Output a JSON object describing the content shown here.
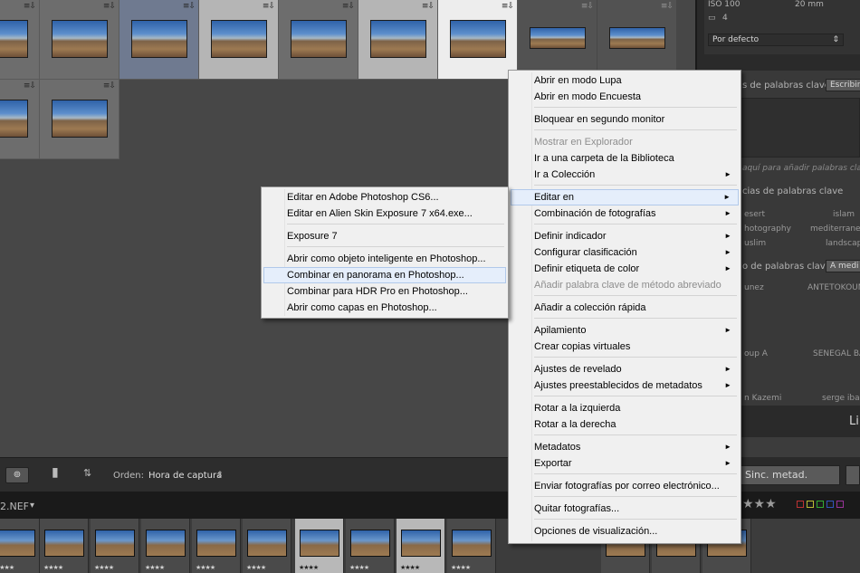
{
  "toolbar": {
    "sort_label": "Orden:",
    "sort_value": "Hora de captura",
    "sort_caret": "⇕"
  },
  "filmstrip_header": {
    "file_name": "2.NEF",
    "caret": "▾"
  },
  "right_panel": {
    "iso": "ISO 100",
    "focal": "20 mm",
    "count": "4",
    "preset_value": "Por defecto",
    "kw_tags_label": "s de palabras clave",
    "kw_enter_button": "Escribir",
    "kw_add_hint": "aquí para añadir palabras clave",
    "kw_suggest_label": "cias de palabras clave",
    "suggest_keywords": [
      "esert",
      "islam",
      "hotography",
      "mediterranean",
      "uslim",
      "landscape"
    ],
    "kw_set_label": "o de palabras clave",
    "kw_set_button": "A medi",
    "set_keywords": [
      "unez",
      "ANTETOKOUN",
      "oup A",
      "SENEGAL BA",
      "n Kazemi",
      "serge ibaka"
    ],
    "lib_letter": "Li",
    "sync_button": "Sinc. metad.",
    "stars": "★★★"
  },
  "context_menu": {
    "items": [
      {
        "label": "Abrir en modo Lupa",
        "disabled": false,
        "submenu": false
      },
      {
        "label": "Abrir en modo Encuesta",
        "disabled": false,
        "submenu": false
      },
      {
        "label": "Bloquear en segundo monitor",
        "disabled": false,
        "submenu": false
      },
      {
        "label": "Mostrar en Explorador",
        "disabled": true,
        "submenu": false
      },
      {
        "label": "Ir a una carpeta de la Biblioteca",
        "disabled": false,
        "submenu": false
      },
      {
        "label": "Ir a Colección",
        "disabled": false,
        "submenu": true
      },
      {
        "label": "Editar en",
        "disabled": false,
        "submenu": true
      },
      {
        "label": "Combinación de fotografías",
        "disabled": false,
        "submenu": true
      },
      {
        "label": "Definir indicador",
        "disabled": false,
        "submenu": true
      },
      {
        "label": "Configurar clasificación",
        "disabled": false,
        "submenu": true
      },
      {
        "label": "Definir etiqueta de color",
        "disabled": false,
        "submenu": true
      },
      {
        "label": "Añadir palabra clave de método abreviado",
        "disabled": true,
        "submenu": false
      },
      {
        "label": "Añadir a colección rápida",
        "disabled": false,
        "submenu": false
      },
      {
        "label": "Apilamiento",
        "disabled": false,
        "submenu": true
      },
      {
        "label": "Crear copias virtuales",
        "disabled": false,
        "submenu": false
      },
      {
        "label": "Ajustes de revelado",
        "disabled": false,
        "submenu": true
      },
      {
        "label": "Ajustes preestablecidos de metadatos",
        "disabled": false,
        "submenu": true
      },
      {
        "label": "Rotar a la izquierda",
        "disabled": false,
        "submenu": false
      },
      {
        "label": "Rotar a la derecha",
        "disabled": false,
        "submenu": false
      },
      {
        "label": "Metadatos",
        "disabled": false,
        "submenu": true
      },
      {
        "label": "Exportar",
        "disabled": false,
        "submenu": true
      },
      {
        "label": "Enviar fotografías por correo electrónico...",
        "disabled": false,
        "submenu": false
      },
      {
        "label": "Quitar fotografías...",
        "disabled": false,
        "submenu": false
      },
      {
        "label": "Opciones de visualización...",
        "disabled": false,
        "submenu": false
      }
    ],
    "arrow_glyph": "►"
  },
  "submenu": {
    "items": [
      {
        "label": "Editar en Adobe Photoshop CS6..."
      },
      {
        "label": "Editar en Alien Skin Exposure 7 x64.exe..."
      },
      {
        "label": "Exposure 7"
      },
      {
        "label": "Abrir como objeto inteligente en Photoshop..."
      },
      {
        "label": "Combinar en panorama en Photoshop..."
      },
      {
        "label": "Combinar para HDR Pro en Photoshop..."
      },
      {
        "label": "Abrir como capas en Photoshop..."
      }
    ]
  },
  "grid_badge": "≡⇩",
  "film_stars": "★★★★"
}
